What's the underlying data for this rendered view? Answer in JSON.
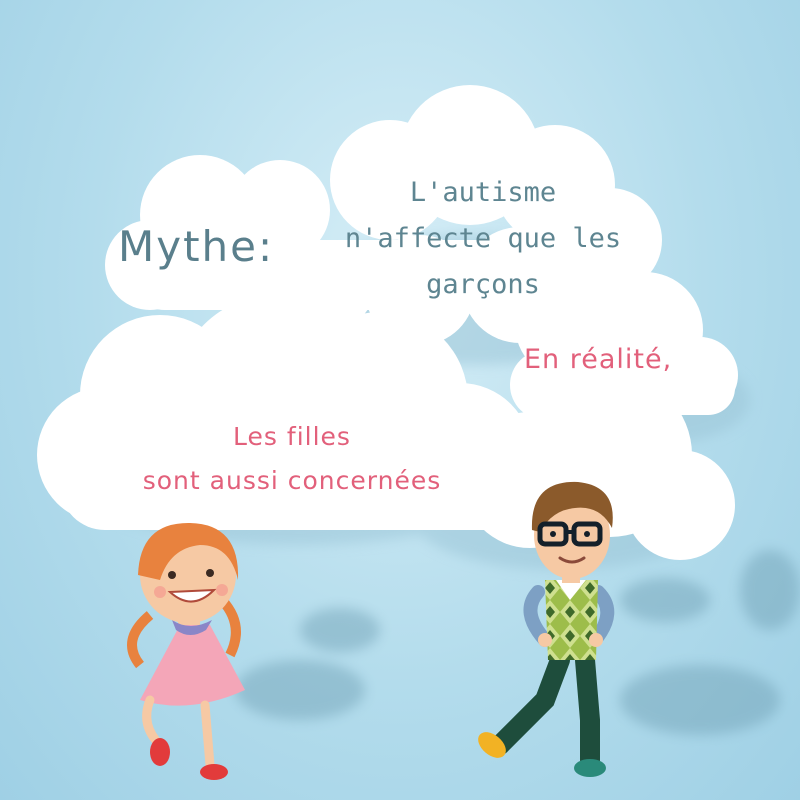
{
  "myth": {
    "label": "Mythe:",
    "lines": [
      "L'autisme",
      "n'affecte que les",
      "garçons"
    ]
  },
  "reality": {
    "label": "En réalité,",
    "lines": [
      "Les filles",
      "sont aussi concernées"
    ]
  },
  "colors": {
    "sky": "#b3dcec",
    "myth_text": "#5e8591",
    "reality_text": "#e2607b",
    "cloud": "#ffffff"
  },
  "icons": [
    "cloud",
    "girl-character",
    "boy-character"
  ]
}
